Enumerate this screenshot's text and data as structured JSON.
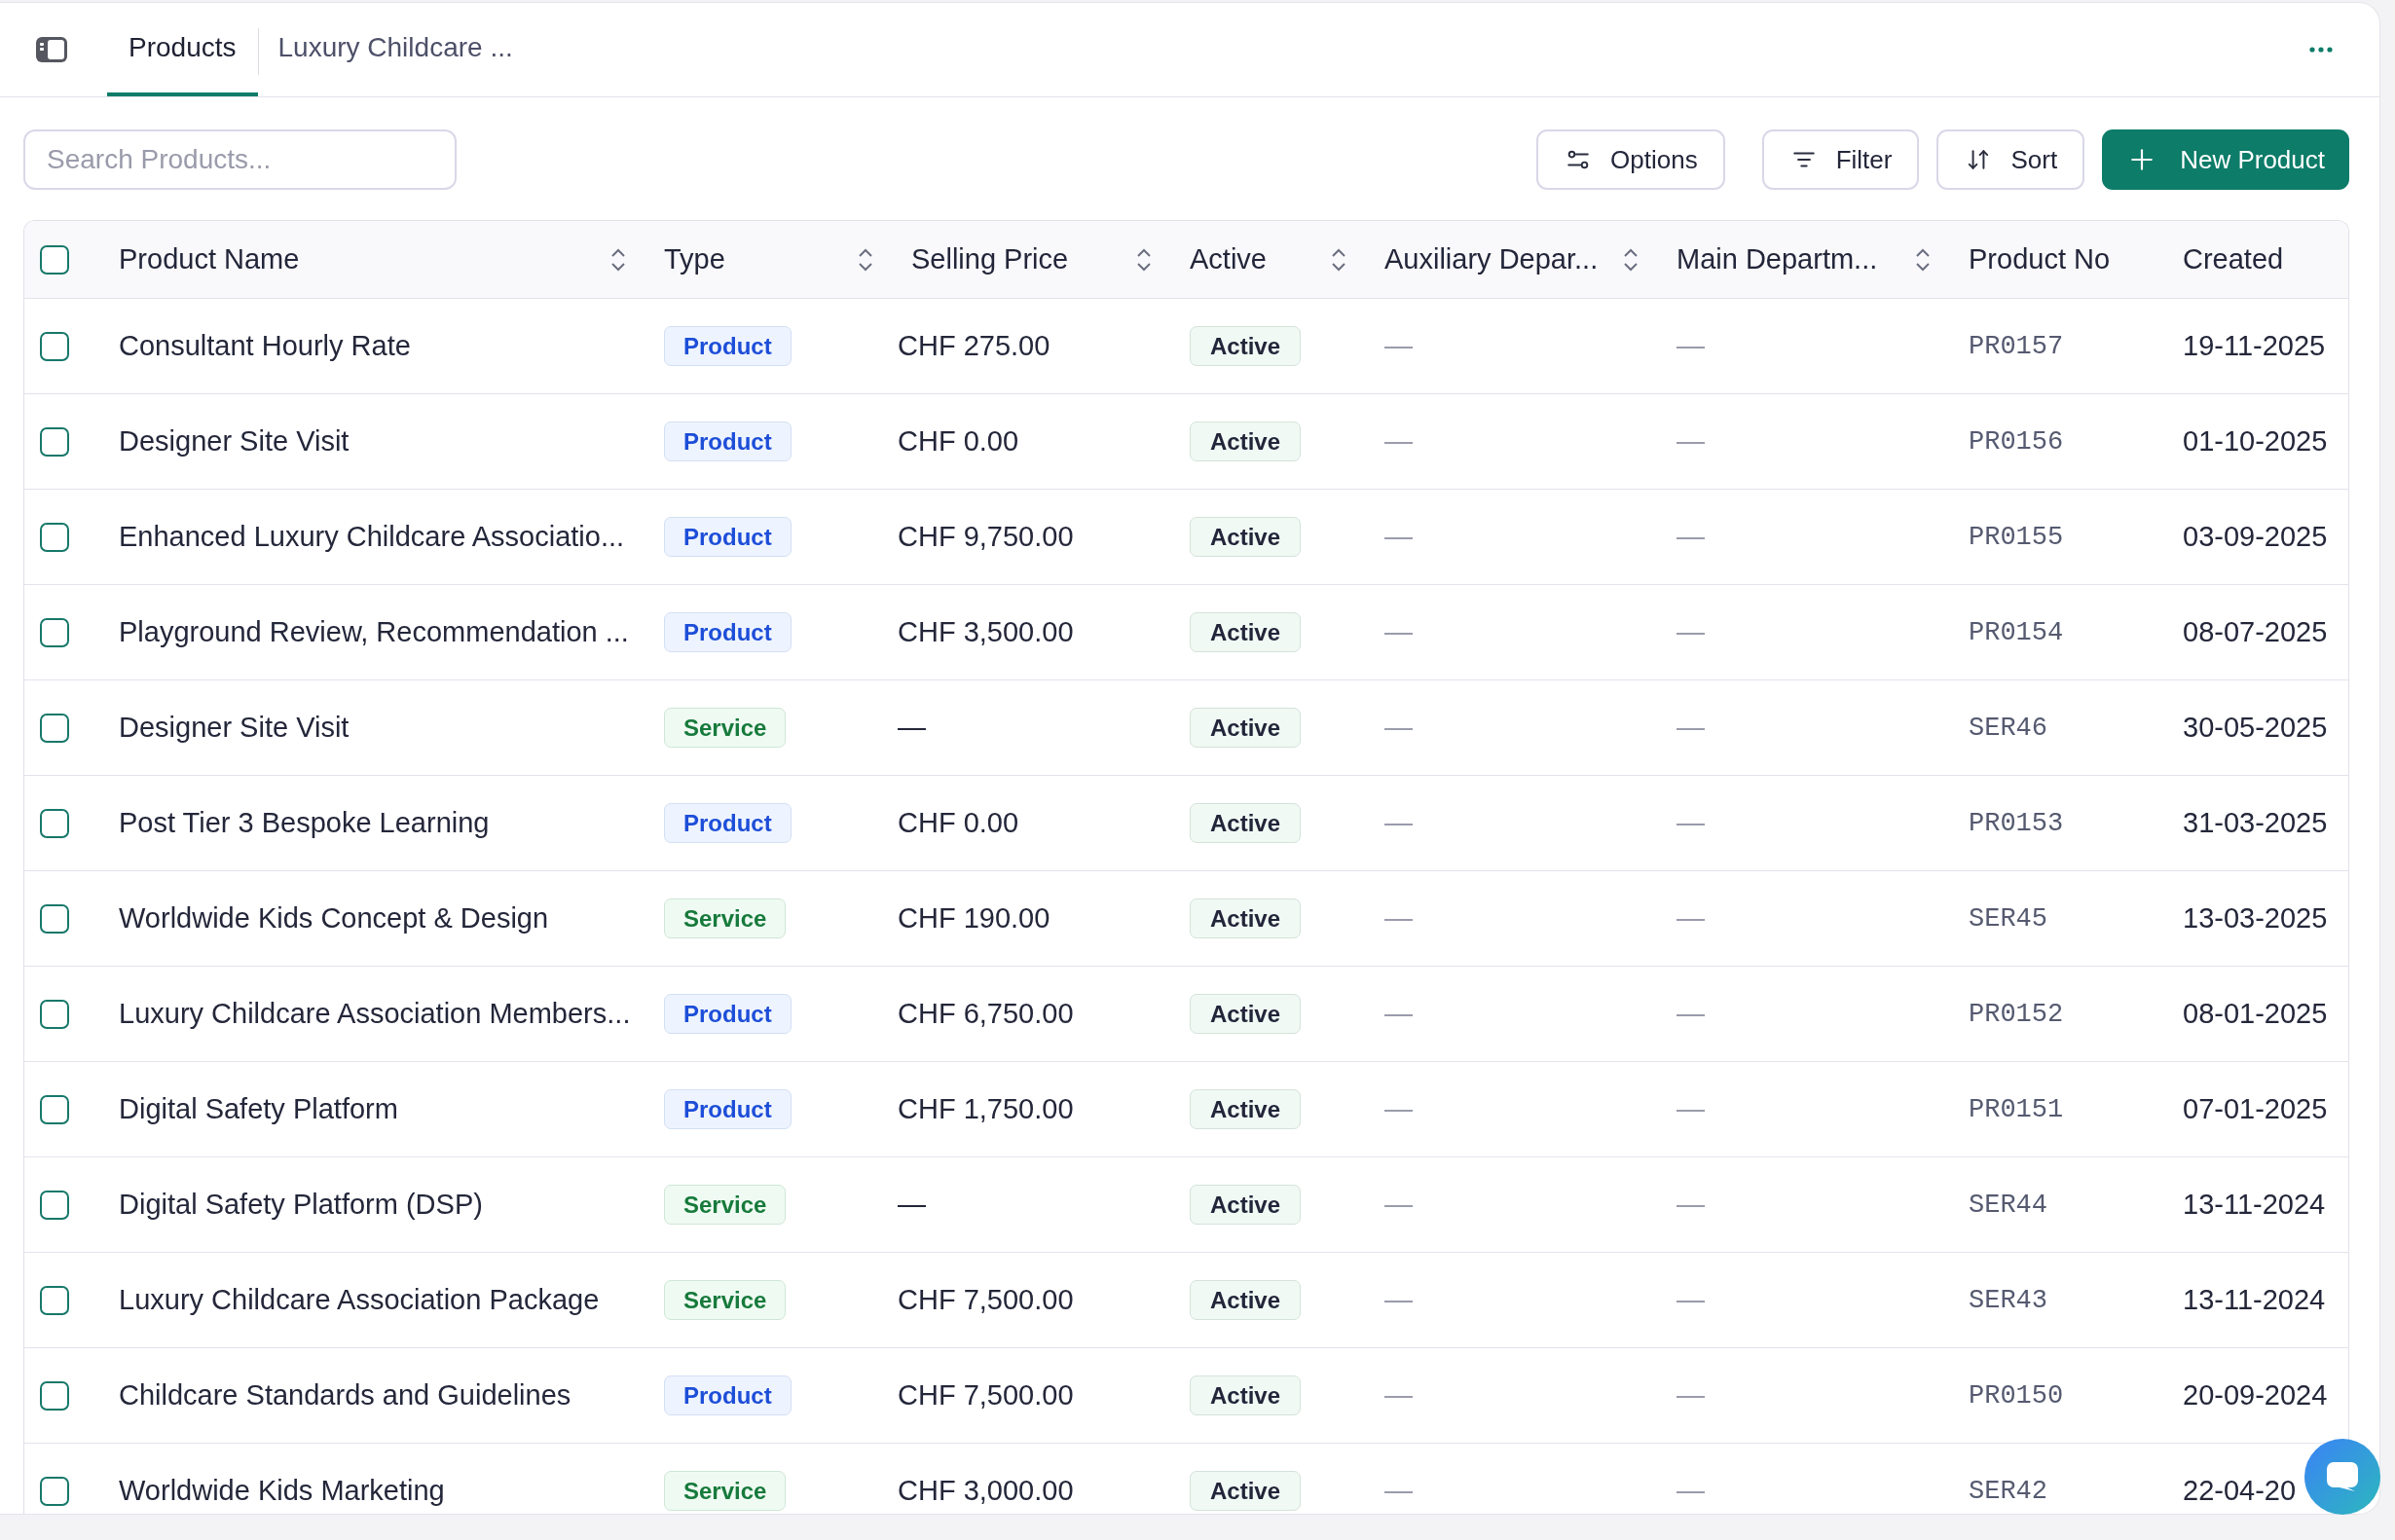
{
  "top_bar": {
    "tabs": [
      {
        "label": "Products",
        "selected": true
      },
      {
        "label": "Luxury Childcare ...",
        "selected": false
      }
    ]
  },
  "toolbar": {
    "search": {
      "placeholder": "Search Products..."
    },
    "buttons": [
      {
        "label": "Options",
        "kind": "options"
      },
      {
        "label": "Filter",
        "kind": "filter"
      },
      {
        "label": "Sort",
        "kind": "sort"
      },
      {
        "label": "New Product",
        "kind": "create"
      }
    ]
  },
  "table": {
    "select_all": {
      "checked": false
    },
    "columns": [
      {
        "label": "Product Name",
        "sortable": true
      },
      {
        "label": "Type",
        "sortable": true
      },
      {
        "label": "Selling Price",
        "sortable": true
      },
      {
        "label": "Active",
        "sortable": true
      },
      {
        "label": "Auxiliary Depar...",
        "sortable": true
      },
      {
        "label": "Main Departm...",
        "sortable": true
      },
      {
        "label": "Product No",
        "sortable": false
      },
      {
        "label": "Created",
        "sortable": false
      }
    ],
    "rows": [
      {
        "checked": false,
        "name": "Consultant Hourly Rate",
        "type": {
          "label": "Product",
          "kind": "product"
        },
        "price": "CHF 275.00",
        "status": {
          "label": "Active",
          "kind": "active"
        },
        "auxiliary_department": "—",
        "main_department": "—",
        "product_no": "PR0157",
        "created": "19-11-2025"
      },
      {
        "checked": false,
        "name": "Designer Site Visit",
        "type": {
          "label": "Product",
          "kind": "product"
        },
        "price": "CHF 0.00",
        "status": {
          "label": "Active",
          "kind": "active"
        },
        "auxiliary_department": "—",
        "main_department": "—",
        "product_no": "PR0156",
        "created": "01-10-2025"
      },
      {
        "checked": false,
        "name": "Enhanced Luxury Childcare Associatio...",
        "type": {
          "label": "Product",
          "kind": "product"
        },
        "price": "CHF 9,750.00",
        "status": {
          "label": "Active",
          "kind": "active"
        },
        "auxiliary_department": "—",
        "main_department": "—",
        "product_no": "PR0155",
        "created": "03-09-2025"
      },
      {
        "checked": false,
        "name": "Playground Review, Recommendation ...",
        "type": {
          "label": "Product",
          "kind": "product"
        },
        "price": "CHF 3,500.00",
        "status": {
          "label": "Active",
          "kind": "active"
        },
        "auxiliary_department": "—",
        "main_department": "—",
        "product_no": "PR0154",
        "created": "08-07-2025"
      },
      {
        "checked": false,
        "name": "Designer Site Visit",
        "type": {
          "label": "Service",
          "kind": "service"
        },
        "price": "—",
        "status": {
          "label": "Active",
          "kind": "active"
        },
        "auxiliary_department": "—",
        "main_department": "—",
        "product_no": "SER46",
        "created": "30-05-2025"
      },
      {
        "checked": false,
        "name": "Post Tier 3 Bespoke Learning",
        "type": {
          "label": "Product",
          "kind": "product"
        },
        "price": "CHF 0.00",
        "status": {
          "label": "Active",
          "kind": "active"
        },
        "auxiliary_department": "—",
        "main_department": "—",
        "product_no": "PR0153",
        "created": "31-03-2025"
      },
      {
        "checked": false,
        "name": "Worldwide Kids Concept & Design",
        "type": {
          "label": "Service",
          "kind": "service"
        },
        "price": "CHF 190.00",
        "status": {
          "label": "Active",
          "kind": "active"
        },
        "auxiliary_department": "—",
        "main_department": "—",
        "product_no": "SER45",
        "created": "13-03-2025"
      },
      {
        "checked": false,
        "name": "Luxury Childcare Association Members...",
        "type": {
          "label": "Product",
          "kind": "product"
        },
        "price": "CHF 6,750.00",
        "status": {
          "label": "Active",
          "kind": "active"
        },
        "auxiliary_department": "—",
        "main_department": "—",
        "product_no": "PR0152",
        "created": "08-01-2025"
      },
      {
        "checked": false,
        "name": "Digital Safety Platform",
        "type": {
          "label": "Product",
          "kind": "product"
        },
        "price": "CHF 1,750.00",
        "status": {
          "label": "Active",
          "kind": "active"
        },
        "auxiliary_department": "—",
        "main_department": "—",
        "product_no": "PR0151",
        "created": "07-01-2025"
      },
      {
        "checked": false,
        "name": "Digital Safety Platform (DSP)",
        "type": {
          "label": "Service",
          "kind": "service"
        },
        "price": "—",
        "status": {
          "label": "Active",
          "kind": "active"
        },
        "auxiliary_department": "—",
        "main_department": "—",
        "product_no": "SER44",
        "created": "13-11-2024"
      },
      {
        "checked": false,
        "name": "Luxury Childcare Association Package",
        "type": {
          "label": "Service",
          "kind": "service"
        },
        "price": "CHF 7,500.00",
        "status": {
          "label": "Active",
          "kind": "active"
        },
        "auxiliary_department": "—",
        "main_department": "—",
        "product_no": "SER43",
        "created": "13-11-2024"
      },
      {
        "checked": false,
        "name": "Childcare Standards and Guidelines",
        "type": {
          "label": "Product",
          "kind": "product"
        },
        "price": "CHF 7,500.00",
        "status": {
          "label": "Active",
          "kind": "active"
        },
        "auxiliary_department": "—",
        "main_department": "—",
        "product_no": "PR0150",
        "created": "20-09-2024"
      },
      {
        "checked": false,
        "name": "Worldwide Kids Marketing",
        "type": {
          "label": "Service",
          "kind": "service"
        },
        "price": "CHF 3,000.00",
        "status": {
          "label": "Active",
          "kind": "active"
        },
        "auxiliary_department": "—",
        "main_department": "—",
        "product_no": "SER42",
        "created": "22-04-20"
      }
    ]
  }
}
